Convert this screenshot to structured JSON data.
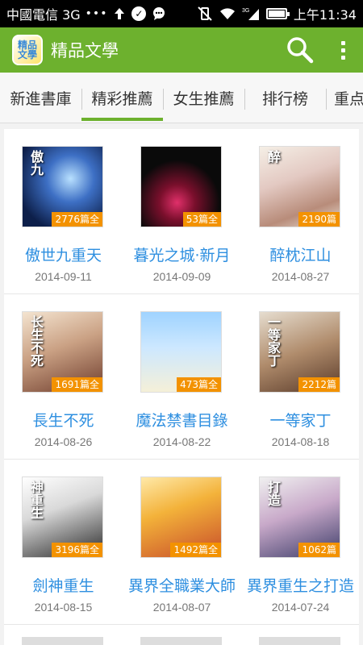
{
  "status_bar": {
    "carrier": "中國電信 3G",
    "dots": "•••",
    "signal_label": "3G",
    "time": "上午11:34"
  },
  "app_bar": {
    "logo_text": "精品文學",
    "title": "精品文學",
    "search_icon": "search-icon",
    "menu_icon": "overflow-menu-icon"
  },
  "tabs": [
    {
      "label": "新進書庫",
      "active": false
    },
    {
      "label": "精彩推薦",
      "active": true
    },
    {
      "label": "女生推薦",
      "active": false
    },
    {
      "label": "排行榜",
      "active": false
    },
    {
      "label": "重点",
      "active": false
    }
  ],
  "books": [
    {
      "title": "傲世九重天",
      "date": "2014-09-11",
      "count": "2776篇全",
      "cover_text": "傲九"
    },
    {
      "title": "暮光之城·新月",
      "date": "2014-09-09",
      "count": "53篇全",
      "cover_text": ""
    },
    {
      "title": "醉枕江山",
      "date": "2014-08-27",
      "count": "2190篇",
      "cover_text": "醉"
    },
    {
      "title": "長生不死",
      "date": "2014-08-26",
      "count": "1691篇全",
      "cover_text": "长生不死"
    },
    {
      "title": "魔法禁書目錄",
      "date": "2014-08-22",
      "count": "473篇全",
      "cover_text": ""
    },
    {
      "title": "一等家丁",
      "date": "2014-08-18",
      "count": "2212篇",
      "cover_text": "一等家丁"
    },
    {
      "title": "劍神重生",
      "date": "2014-08-15",
      "count": "3196篇全",
      "cover_text": "神重生"
    },
    {
      "title": "異界全職業大師",
      "date": "2014-08-07",
      "count": "1492篇全",
      "cover_text": ""
    },
    {
      "title": "異界重生之打造",
      "date": "2014-07-24",
      "count": "1062篇",
      "cover_text": "打造"
    }
  ],
  "colors": {
    "accent": "#6db12e",
    "title_link": "#2e8fe0",
    "badge": "#f39200"
  }
}
